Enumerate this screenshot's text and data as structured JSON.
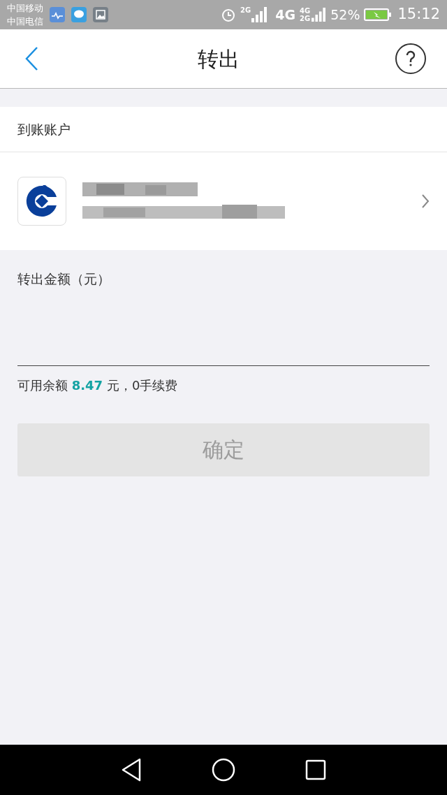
{
  "status_bar": {
    "carriers": [
      "中国移动",
      "中国电信"
    ],
    "network_1": "2G",
    "network_2": "4G",
    "network_3_top": "4G",
    "network_3_bottom": "2G",
    "battery": "52%",
    "time": "15:12"
  },
  "nav": {
    "title": "转出"
  },
  "account_section": {
    "header": "到账账户"
  },
  "amount": {
    "label": "转出金额（元）"
  },
  "balance_note": "可用余额 **8.47** 元，0手续费",
  "confirm_button": {
    "label": "确定",
    "disabled": true
  }
}
